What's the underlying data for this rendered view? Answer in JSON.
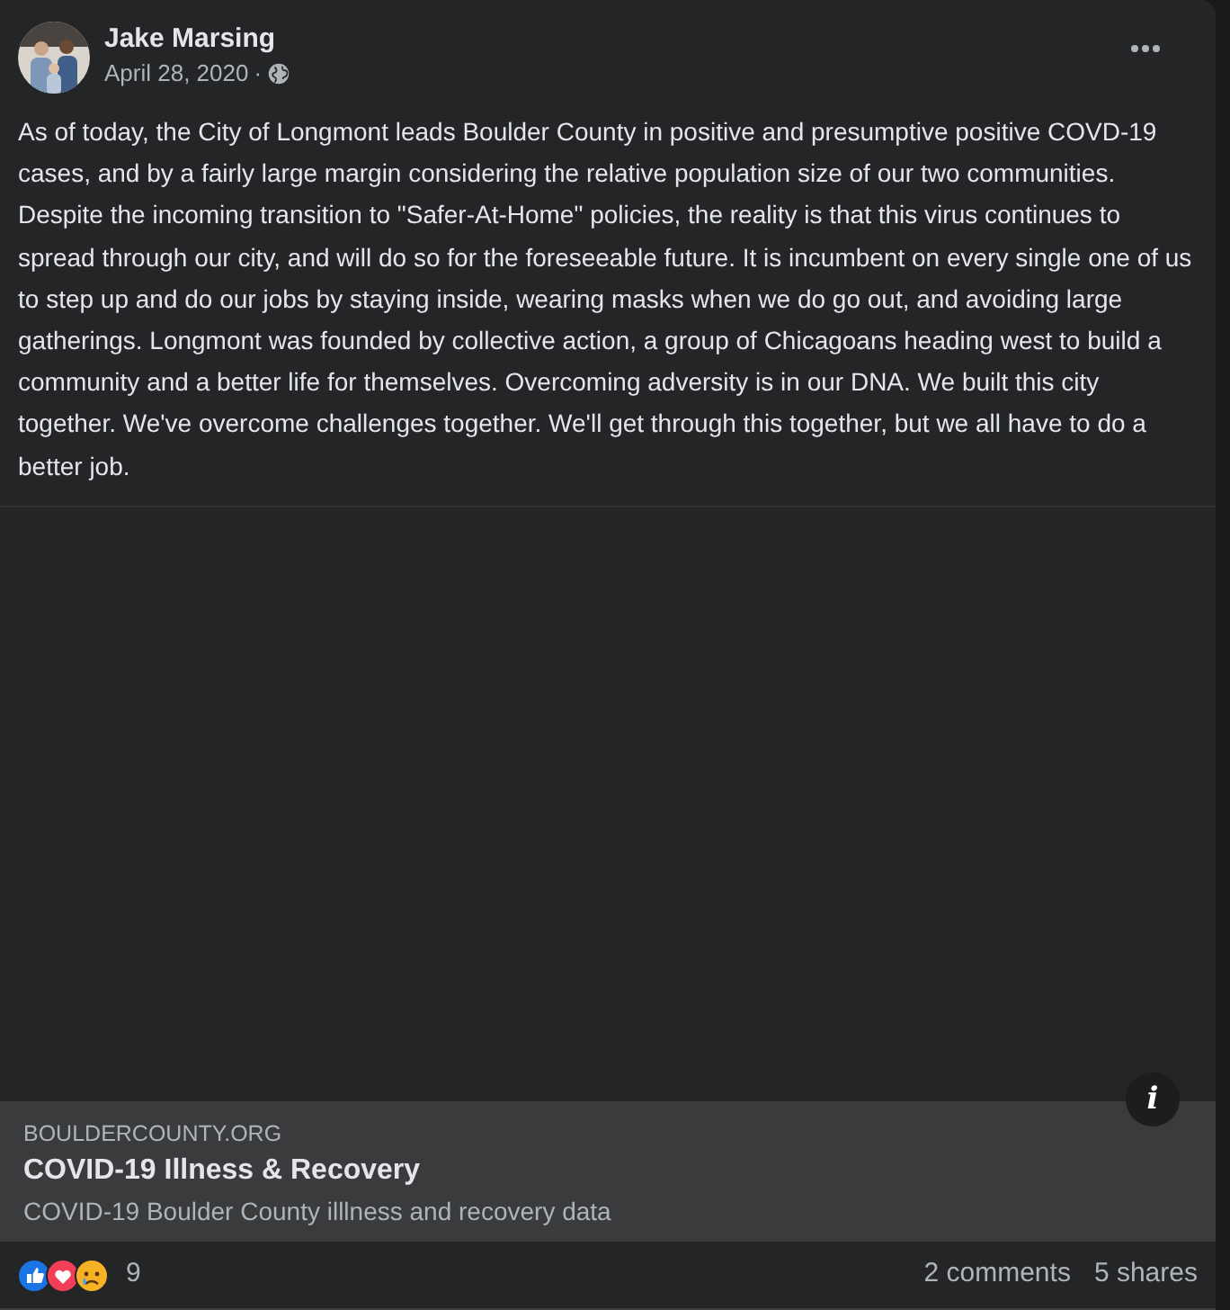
{
  "post": {
    "author": "Jake Marsing",
    "date": "April 28, 2020",
    "separator": "·",
    "body": "As of today, the City of Longmont leads Boulder County in positive and presumptive positive COVD-19 cases, and by a fairly large margin considering the relative population size of our two communities. Despite the incoming transition to \"Safer-At-Home\" policies, the reality is that this virus continues to spread through our city, and will do so for the foreseeable future. It is incumbent on every single one of us to step up and do our jobs by staying inside, wearing masks when we do go out, and avoiding large gatherings. Longmont was founded by collective action, a group of Chicagoans heading west to build a community and a better life for themselves. Overcoming adversity is in our DNA. We built this city together. We've overcome challenges together. We'll get through this together, but we all have to do a better job."
  },
  "link_preview": {
    "domain": "BOULDERCOUNTY.ORG",
    "title": "COVID-19 Illness & Recovery",
    "description": "COVID-19 Boulder County illlness and recovery data",
    "info_badge": "i"
  },
  "footer": {
    "reaction_count": "9",
    "comments": "2 comments",
    "shares": "5 shares"
  }
}
